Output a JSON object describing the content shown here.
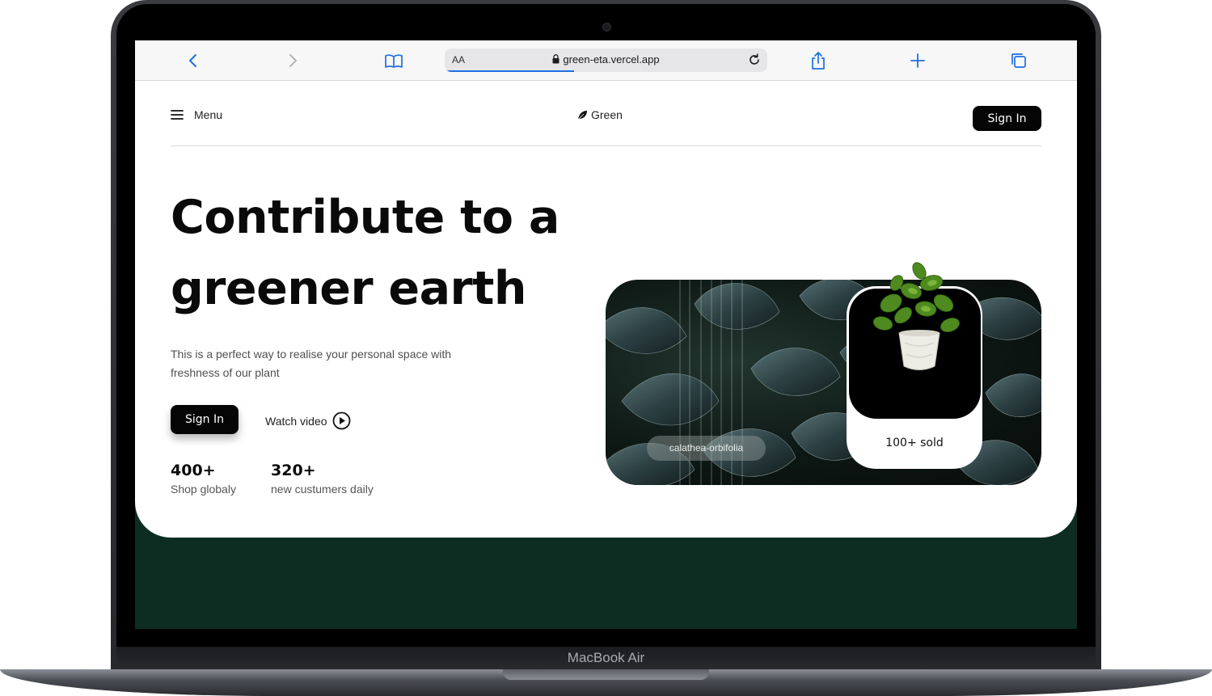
{
  "device": {
    "label": "MacBook Air"
  },
  "browser": {
    "reader_label": "AA",
    "url": "green-eta.vercel.app"
  },
  "nav": {
    "menu_label": "Menu",
    "brand": "Green",
    "signin_label": "Sign In"
  },
  "hero": {
    "title": "Contribute to a greener earth",
    "description": "This is a perfect way to realise your personal space with freshness of our plant",
    "signin_label": "Sign In",
    "watch_label": "Watch video",
    "stats": [
      {
        "value": "400+",
        "label": "Shop globaly"
      },
      {
        "value": "320+",
        "label": "new custumers daily"
      }
    ]
  },
  "showcase": {
    "species_tag": "calathea-orbifolia",
    "sold_text": "100+ sold"
  },
  "colors": {
    "primary": "#050505",
    "footer_bg": "#0d2d23",
    "link_blue": "#1d6fe0"
  }
}
